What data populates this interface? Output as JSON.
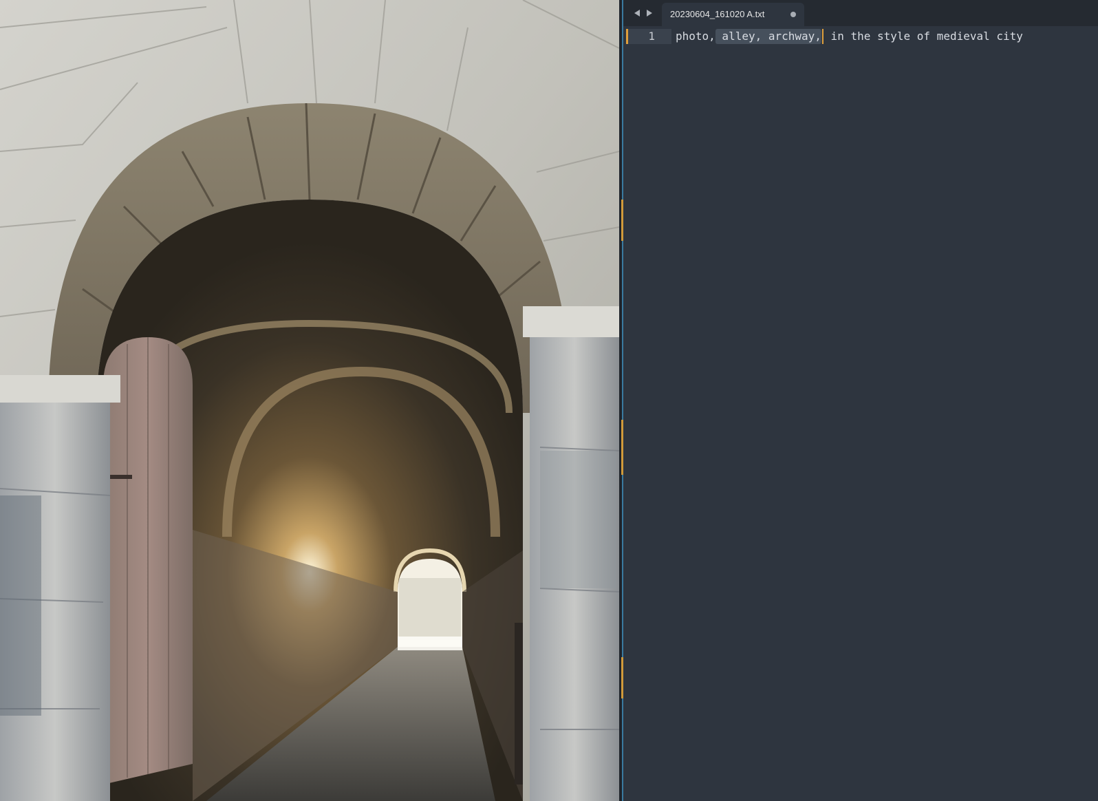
{
  "tab": {
    "filename": "20230604_161020 A.txt",
    "modified_indicator": "dot-icon"
  },
  "nav": {
    "back_icon": "triangle-left-icon",
    "forward_icon": "triangle-right-icon"
  },
  "editor": {
    "line_number": "1",
    "text_before": "photo,",
    "text_selected": " alley, archway,",
    "text_after": " in the style of medieval city"
  },
  "colors": {
    "editor_bg": "#2e353f",
    "tabbar_bg": "#252a31",
    "caret": "#e0a03c",
    "selection": "#46505c"
  },
  "image": {
    "subject": "stone-archway-tunnel-photo"
  }
}
